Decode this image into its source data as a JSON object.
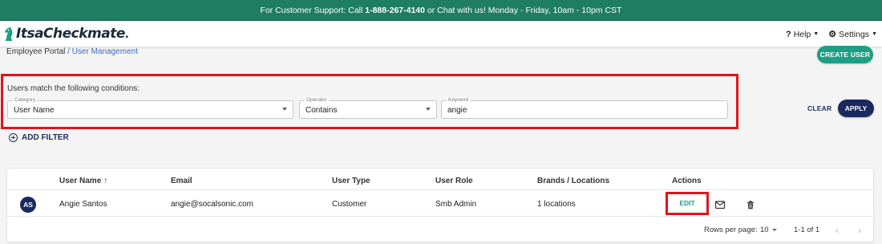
{
  "banner": {
    "prefix": "For Customer Support: Call ",
    "phone": "1-888-267-4140",
    "suffix": " or Chat with us! Monday - Friday, 10am - 10pm CST"
  },
  "header": {
    "logo_text": "ItsaCheckmate",
    "logo_dot": ".",
    "help_label": "Help",
    "settings_label": "Settings"
  },
  "breadcrumb": {
    "root": "Employee Portal",
    "current": "/ User Management"
  },
  "actions": {
    "create_user": "CREATE USER",
    "clear": "CLEAR",
    "apply": "APPLY",
    "add_filter": "ADD FILTER"
  },
  "filter": {
    "conditions_label": "Users match the following conditions:",
    "category": {
      "label": "Category",
      "value": "User Name"
    },
    "operator": {
      "label": "Operator",
      "value": "Contains"
    },
    "keyword": {
      "label": "Keyword",
      "value": "angie"
    }
  },
  "table": {
    "columns": [
      "User Name",
      "Email",
      "User Type",
      "User Role",
      "Brands / Locations",
      "Actions"
    ],
    "sort_indicator": "↑",
    "rows": [
      {
        "initials": "AS",
        "name": "Angie Santos",
        "email": "angie@socalsonic.com",
        "type": "Customer",
        "role": "Smb Admin",
        "locations": "1 locations",
        "edit_label": "EDIT"
      }
    ],
    "footer": {
      "rows_per_page_label": "Rows per page:",
      "rows_per_page_value": "10",
      "range": "1-1 of 1"
    }
  },
  "colors": {
    "banner": "#1f7e62",
    "primary_teal": "#1f9e86",
    "navy": "#1a2a5e",
    "highlight_red": "#e1141d"
  },
  "icons": {
    "logo": "chess-knight-icon",
    "help": "question-icon",
    "settings": "gear-icon",
    "add_filter": "plus-circle-icon",
    "email": "envelope-icon",
    "delete": "trash-icon",
    "prev": "chevron-left-icon",
    "next": "chevron-right-icon"
  }
}
